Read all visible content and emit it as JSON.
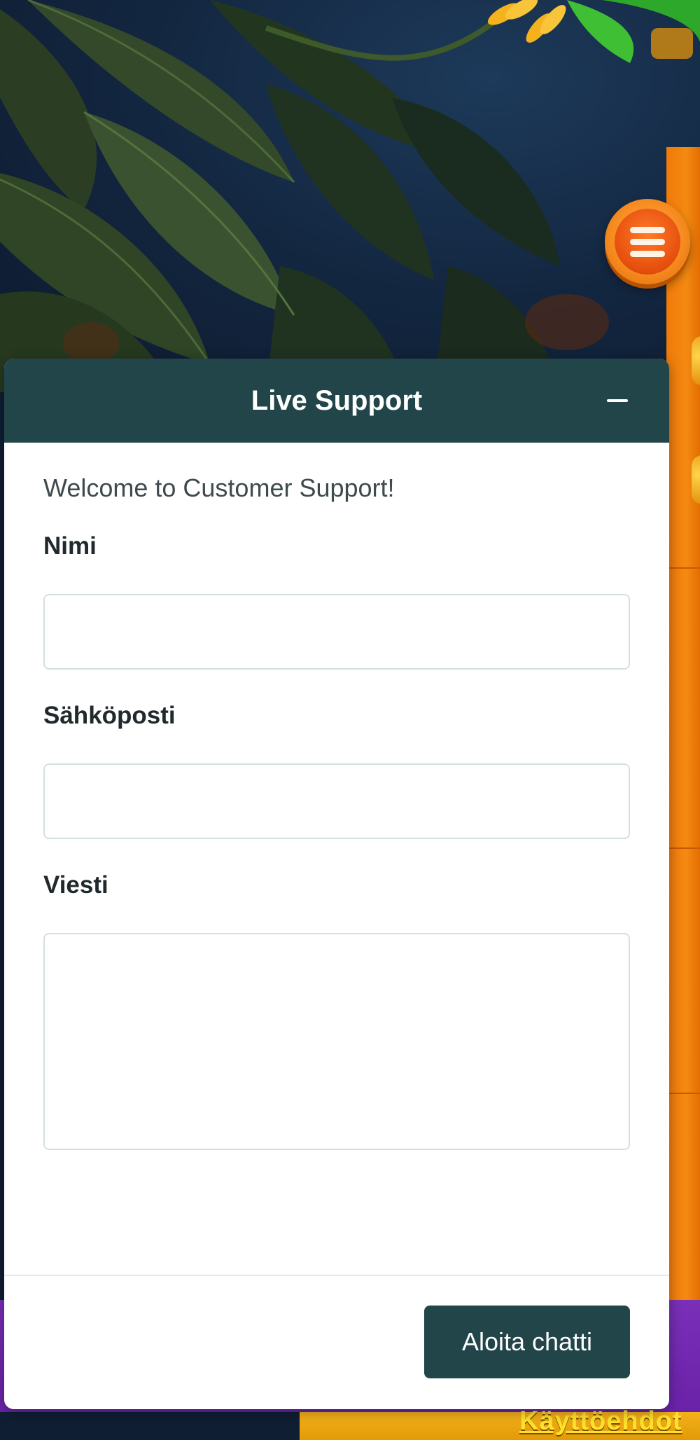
{
  "background": {
    "menu_icon": "hamburger-menu-icon",
    "terms_link_label": "Käyttöehdot",
    "colors": {
      "orange": "#f07a09",
      "purple": "#6a22a8",
      "navy": "#0f1e33"
    }
  },
  "chat": {
    "title": "Live Support",
    "minimize_icon": "minus-icon",
    "welcome": "Welcome to Customer Support!",
    "fields": {
      "name_label": "Nimi",
      "name_value": "",
      "email_label": "Sähköposti",
      "email_value": "",
      "message_label": "Viesti",
      "message_value": ""
    },
    "start_button": "Aloita chatti",
    "colors": {
      "header": "#214548",
      "button": "#214548"
    }
  }
}
